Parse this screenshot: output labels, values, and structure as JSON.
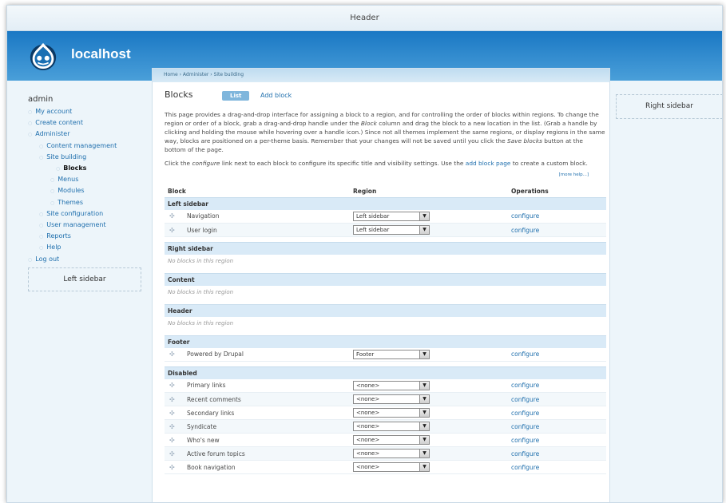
{
  "header": {
    "title": "Header"
  },
  "site": {
    "name": "localhost",
    "logo_icon": "drupal-drop-icon"
  },
  "breadcrumb": "Home › Administer › Site building",
  "page": {
    "title": "Blocks",
    "tabs": [
      {
        "label": "List",
        "active": true
      },
      {
        "label": "Add block",
        "active": false
      }
    ],
    "desc1_a": "This page provides a drag-and-drop interface for assigning a block to a region, and for controlling the order of blocks within regions. To change the region or order of a block, grab a drag-and-drop handle under the ",
    "desc1_em1": "Block",
    "desc1_b": " column and drag the block to a new location in the list. (Grab a handle by clicking and holding the mouse while hovering over a handle icon.) Since not all themes implement the same regions, or display regions in the same way, blocks are positioned on a per-theme basis. Remember that your changes will not be saved until you click the ",
    "desc1_em2": "Save blocks",
    "desc1_c": " button at the bottom of the page.",
    "desc2_a": "Click the ",
    "desc2_em": "configure",
    "desc2_b": " link next to each block to configure its specific title and visibility settings. Use the ",
    "desc2_link": "add block page",
    "desc2_c": " to create a custom block.",
    "more_help": "[more help...]"
  },
  "table": {
    "headers": {
      "block": "Block",
      "region": "Region",
      "operations": "Operations"
    },
    "empty_text": "No blocks in this region",
    "configure_label": "configure",
    "regions": {
      "left_sidebar": "Left sidebar",
      "right_sidebar": "Right sidebar",
      "content": "Content",
      "header": "Header",
      "footer": "Footer",
      "disabled": "Disabled"
    },
    "left_rows": [
      {
        "name": "Navigation",
        "region": "Left sidebar"
      },
      {
        "name": "User login",
        "region": "Left sidebar"
      }
    ],
    "footer_rows": [
      {
        "name": "Powered by Drupal",
        "region": "Footer"
      }
    ],
    "disabled_rows": [
      {
        "name": "Primary links",
        "region": "<none>"
      },
      {
        "name": "Recent comments",
        "region": "<none>"
      },
      {
        "name": "Secondary links",
        "region": "<none>"
      },
      {
        "name": "Syndicate",
        "region": "<none>"
      },
      {
        "name": "Who's new",
        "region": "<none>"
      },
      {
        "name": "Active forum topics",
        "region": "<none>"
      },
      {
        "name": "Book navigation",
        "region": "<none>"
      }
    ]
  },
  "user_menu": {
    "user": "admin",
    "items": [
      {
        "label": "My account",
        "level": 1
      },
      {
        "label": "Create content",
        "level": 1
      },
      {
        "label": "Administer",
        "level": 1
      },
      {
        "label": "Content management",
        "level": 2
      },
      {
        "label": "Site building",
        "level": 2
      },
      {
        "label": "Blocks",
        "level": 4,
        "active": true
      },
      {
        "label": "Menus",
        "level": 3
      },
      {
        "label": "Modules",
        "level": 3
      },
      {
        "label": "Themes",
        "level": 3
      },
      {
        "label": "Site configuration",
        "level": 2
      },
      {
        "label": "User management",
        "level": 2
      },
      {
        "label": "Reports",
        "level": 2
      },
      {
        "label": "Help",
        "level": 2
      },
      {
        "label": "Log out",
        "level": 1
      }
    ]
  },
  "left_sidebar_label": "Left sidebar",
  "right_sidebar_label": "Right sidebar",
  "icons": {
    "drag_handle": "drag-handle-icon",
    "select_arrow": "dropdown-arrow-icon",
    "bullet": "bullet-icon"
  }
}
